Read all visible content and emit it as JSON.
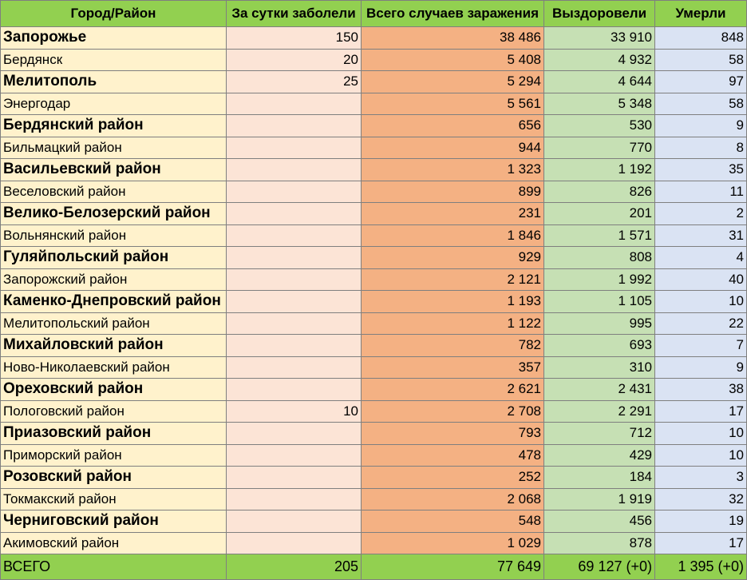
{
  "header": {
    "region": "Город/Район",
    "daily": "За сутки заболели",
    "total": "Всего случаев заражения",
    "recovered": "Выздоровели",
    "died": "Умерли"
  },
  "rows": [
    {
      "name": "Запорожье",
      "daily": "150",
      "total": "38 486",
      "recovered": "33 910",
      "died": "848",
      "major": true
    },
    {
      "name": "Бердянск",
      "daily": "20",
      "total": "5 408",
      "recovered": "4 932",
      "died": "58",
      "major": false
    },
    {
      "name": "Мелитополь",
      "daily": "25",
      "total": "5 294",
      "recovered": "4 644",
      "died": "97",
      "major": true
    },
    {
      "name": "Энергодар",
      "daily": "",
      "total": "5 561",
      "recovered": "5 348",
      "died": "58",
      "major": false
    },
    {
      "name": "Бердянский район",
      "daily": "",
      "total": "656",
      "recovered": "530",
      "died": "9",
      "major": true
    },
    {
      "name": "Бильмацкий район",
      "daily": "",
      "total": "944",
      "recovered": "770",
      "died": "8",
      "major": false
    },
    {
      "name": "Васильевский район",
      "daily": "",
      "total": "1 323",
      "recovered": "1 192",
      "died": "35",
      "major": true
    },
    {
      "name": "Веселовский район",
      "daily": "",
      "total": "899",
      "recovered": "826",
      "died": "11",
      "major": false
    },
    {
      "name": "Велико-Белозерский район",
      "daily": "",
      "total": "231",
      "recovered": "201",
      "died": "2",
      "major": true
    },
    {
      "name": "Вольнянский район",
      "daily": "",
      "total": "1 846",
      "recovered": "1 571",
      "died": "31",
      "major": false
    },
    {
      "name": "Гуляйпольский район",
      "daily": "",
      "total": "929",
      "recovered": "808",
      "died": "4",
      "major": true
    },
    {
      "name": "Запорожский район",
      "daily": "",
      "total": "2 121",
      "recovered": "1 992",
      "died": "40",
      "major": false
    },
    {
      "name": "Каменко-Днепровский район",
      "daily": "",
      "total": "1 193",
      "recovered": "1 105",
      "died": "10",
      "major": true
    },
    {
      "name": "Мелитопольский район",
      "daily": "",
      "total": "1 122",
      "recovered": "995",
      "died": "22",
      "major": false
    },
    {
      "name": "Михайловский район",
      "daily": "",
      "total": "782",
      "recovered": "693",
      "died": "7",
      "major": true
    },
    {
      "name": "Ново-Николаевский район",
      "daily": "",
      "total": "357",
      "recovered": "310",
      "died": "9",
      "major": false
    },
    {
      "name": "Ореховский район",
      "daily": "",
      "total": "2 621",
      "recovered": "2 431",
      "died": "38",
      "major": true
    },
    {
      "name": "Пологовский район",
      "daily": "10",
      "total": "2 708",
      "recovered": "2 291",
      "died": "17",
      "major": false
    },
    {
      "name": "Приазовский район",
      "daily": "",
      "total": "793",
      "recovered": "712",
      "died": "10",
      "major": true
    },
    {
      "name": "Приморский район",
      "daily": "",
      "total": "478",
      "recovered": "429",
      "died": "10",
      "major": false
    },
    {
      "name": "Розовский район",
      "daily": "",
      "total": "252",
      "recovered": "184",
      "died": "3",
      "major": true
    },
    {
      "name": "Токмакский район",
      "daily": "",
      "total": "2 068",
      "recovered": "1 919",
      "died": "32",
      "major": false
    },
    {
      "name": "Черниговский район",
      "daily": "",
      "total": "548",
      "recovered": "456",
      "died": "19",
      "major": true
    },
    {
      "name": "Акимовский район",
      "daily": "",
      "total": "1 029",
      "recovered": "878",
      "died": "17",
      "major": false
    }
  ],
  "footer": {
    "name": "ВСЕГО",
    "daily": "205",
    "total": "77 649",
    "recovered": "69 127 (+0)",
    "died": "1 395 (+0)"
  },
  "colors": {
    "header_bg": "#92d050",
    "name_col_bg": "#fff2cc",
    "daily_col_bg": "#fce4d6",
    "total_col_bg": "#f4b183",
    "recovered_col_bg": "#c6e0b4",
    "died_col_bg": "#dae3f3",
    "footer_bg": "#92d050"
  }
}
